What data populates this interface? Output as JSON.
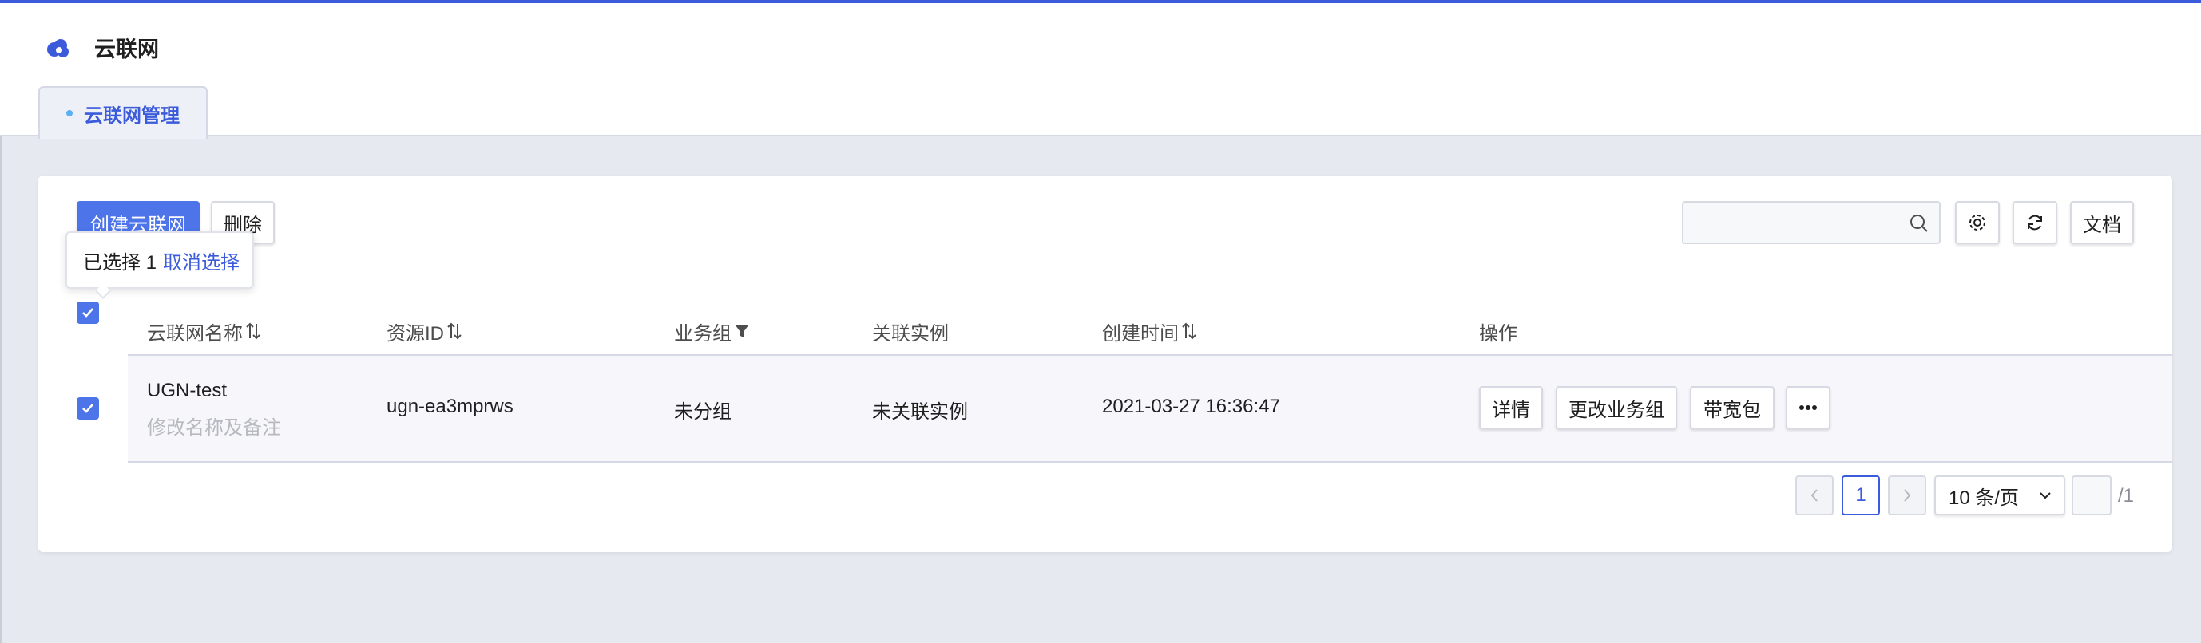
{
  "app": {
    "title": "云联网"
  },
  "tabs": [
    {
      "label": "云联网管理",
      "active": true
    }
  ],
  "toolbar": {
    "create_label": "创建云联网",
    "delete_label": "删除",
    "search_placeholder": "",
    "docs_label": "文档"
  },
  "selection_tip": {
    "text": "已选择 1",
    "cancel_label": "取消选择"
  },
  "table": {
    "columns": [
      "云联网名称",
      "资源ID",
      "业务组",
      "关联实例",
      "创建时间",
      "操作"
    ],
    "rows": [
      {
        "name": "UGN-test",
        "edit_hint": "修改名称及备注",
        "resource_id": "ugn-ea3mprws",
        "group": "未分组",
        "instances": "未关联实例",
        "created": "2021-03-27 16:36:47",
        "actions": [
          "详情",
          "更改业务组",
          "带宽包"
        ]
      }
    ]
  },
  "pagination": {
    "current": "1",
    "page_size": "10 条/页",
    "total": "/1"
  },
  "colors": {
    "accent": "#3b5bdb",
    "primary_button": "#4e74ea",
    "background": "#e7e9f1"
  }
}
